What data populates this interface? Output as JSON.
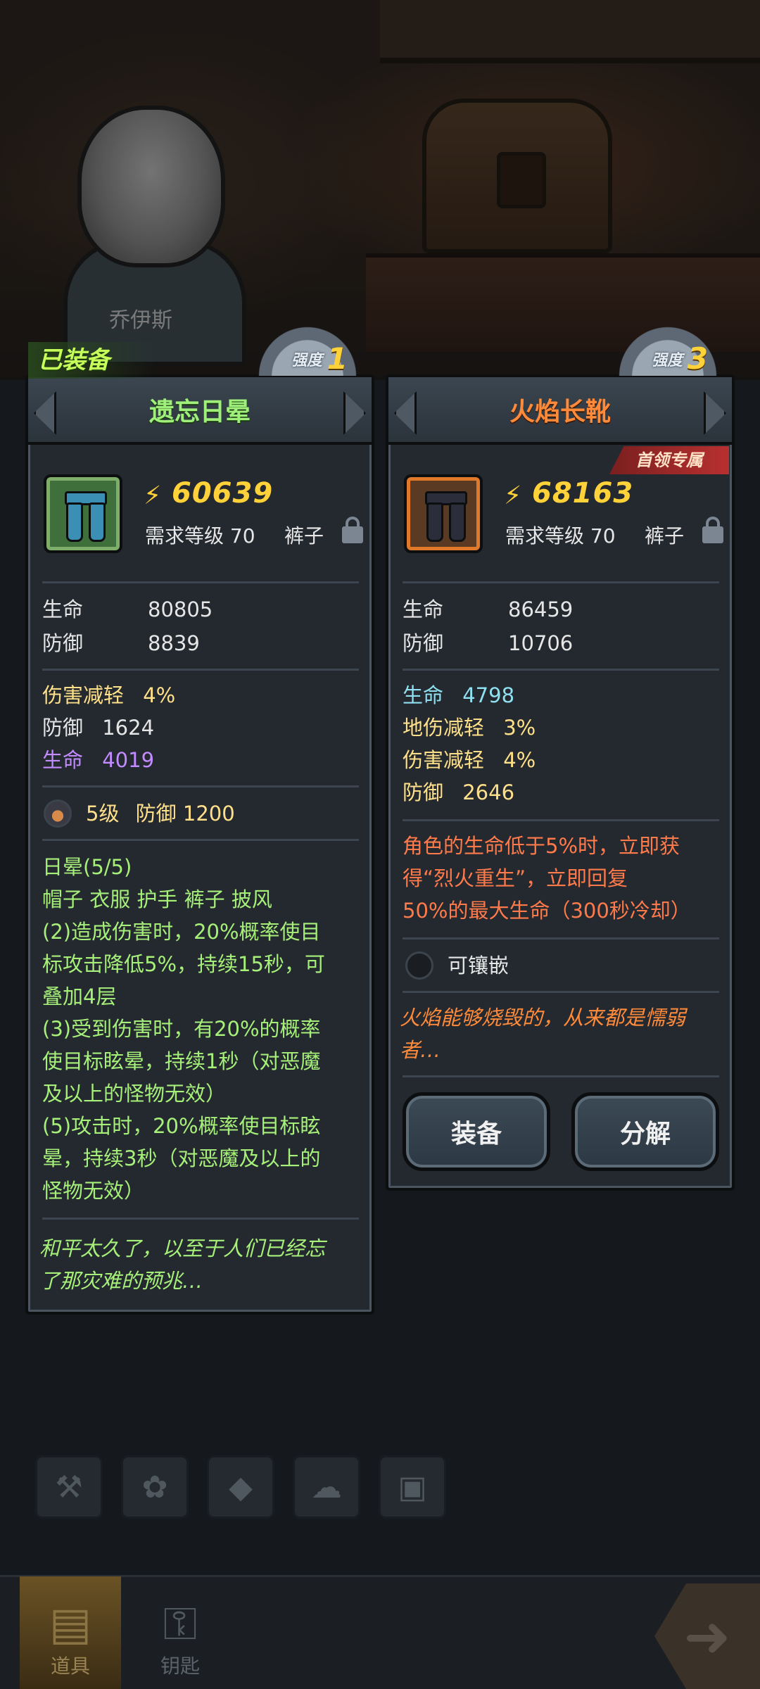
{
  "hero": {
    "name": "乔伊斯"
  },
  "equipped_tag": "已装备",
  "left_item": {
    "name": "遗忘日晕",
    "strength_label": "强度",
    "strength": "1",
    "power": "60639",
    "requirement": "需求等级 70",
    "slot": "裤子",
    "base_stats": [
      {
        "label": "生命",
        "value": "80805"
      },
      {
        "label": "防御",
        "value": "8839"
      }
    ],
    "extra_stats": [
      {
        "label": "伤害减轻",
        "value": "4%",
        "color": "#ffe08a"
      },
      {
        "label": "防御",
        "value": "1624",
        "color": "#e6e6e6"
      },
      {
        "label": "生命",
        "value": "4019",
        "color": "#c28bff"
      }
    ],
    "gem": {
      "level": "5级",
      "bonus": "防御 1200"
    },
    "set": {
      "title": "日晕(5/5)",
      "pieces": "帽子 衣服 护手 裤子 披风",
      "lines": [
        "(2)造成伤害时，20%概率使目",
        "标攻击降低5%，持续15秒，可",
        "叠加4层",
        "(3)受到伤害时，有20%的概率",
        "使目标眩晕，持续1秒（对恶魔",
        "及以上的怪物无效）",
        "(5)攻击时，20%概率使目标眩",
        "晕，持续3秒（对恶魔及以上的",
        "怪物无效）"
      ]
    },
    "flavor": [
      "和平太久了，以至于人们已经忘",
      "了那灾难的预兆…"
    ]
  },
  "right_item": {
    "name": "火焰长靴",
    "strength_label": "强度",
    "strength": "3",
    "badge": "首领专属",
    "power": "68163",
    "requirement": "需求等级 70",
    "slot": "裤子",
    "base_stats": [
      {
        "label": "生命",
        "value": "86459"
      },
      {
        "label": "防御",
        "value": "10706"
      }
    ],
    "extra_stats": [
      {
        "label": "生命",
        "value": "4798",
        "color": "#8fe0f0"
      },
      {
        "label": "地伤减轻",
        "value": "3%",
        "color": "#ffe08a"
      },
      {
        "label": "伤害减轻",
        "value": "4%",
        "color": "#ffe08a"
      },
      {
        "label": "防御",
        "value": "2646",
        "color": "#ffe08a"
      }
    ],
    "special": [
      "角色的生命低于5%时，立即获",
      "得“烈火重生”，立即回复",
      "50%的最大生命（300秒冷却）"
    ],
    "socket_label": "可镶嵌",
    "flavor": [
      "火焰能够烧毁的，从来都是懦弱",
      "者…"
    ],
    "equip_button": "装备",
    "dismantle_button": "分解"
  },
  "bottom_nav": [
    {
      "label": "道具",
      "icon": "backpack-icon",
      "active": true
    },
    {
      "label": "钥匙",
      "icon": "key-icon",
      "active": false
    }
  ],
  "category_tabs": [
    "weapon-icon",
    "paw-icon",
    "gem-icon",
    "material-icon",
    "chest-icon"
  ],
  "colors": {
    "accent_gold": "#ffd23a",
    "title_green": "#9ff07a",
    "title_orange": "#ff8a3a"
  }
}
